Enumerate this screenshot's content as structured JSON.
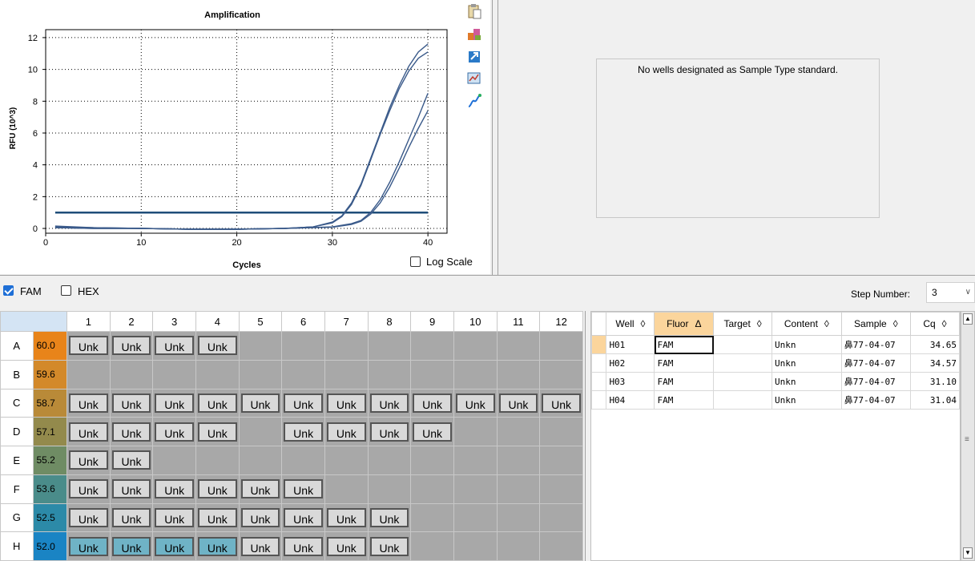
{
  "chart": {
    "title": "Amplification",
    "xlabel": "Cycles",
    "ylabel": "RFU (10^3)",
    "log_scale_label": "Log Scale",
    "log_scale_checked": false
  },
  "chart_data": {
    "type": "line",
    "title": "Amplification",
    "xlabel": "Cycles",
    "ylabel": "RFU (10^3)",
    "xlim": [
      0,
      42
    ],
    "ylim": [
      -0.3,
      12.5
    ],
    "xticks": [
      0,
      10,
      20,
      30,
      40
    ],
    "yticks": [
      0,
      2,
      4,
      6,
      8,
      10,
      12
    ],
    "grid": true,
    "threshold": 1.0,
    "series": [
      {
        "x": [
          1,
          5,
          10,
          15,
          20,
          25,
          28,
          30,
          31,
          32,
          33,
          34,
          35,
          36,
          37,
          38,
          39,
          40
        ],
        "y": [
          0.15,
          0.05,
          0,
          -0.05,
          -0.05,
          0,
          0.1,
          0.4,
          0.8,
          1.6,
          2.8,
          4.4,
          6.0,
          7.6,
          9.0,
          10.2,
          11.1,
          11.6
        ]
      },
      {
        "x": [
          1,
          5,
          10,
          15,
          20,
          25,
          28,
          30,
          31,
          32,
          33,
          34,
          35,
          36,
          37,
          38,
          39,
          40
        ],
        "y": [
          0.1,
          0.05,
          0,
          -0.05,
          -0.05,
          0,
          0.1,
          0.35,
          0.75,
          1.5,
          2.7,
          4.3,
          5.9,
          7.4,
          8.8,
          9.9,
          10.7,
          11.1
        ]
      },
      {
        "x": [
          1,
          5,
          10,
          15,
          20,
          25,
          30,
          32,
          33,
          34,
          35,
          36,
          37,
          38,
          39,
          40
        ],
        "y": [
          0.05,
          0,
          0,
          -0.05,
          -0.05,
          0,
          0.1,
          0.3,
          0.5,
          1.0,
          1.8,
          2.9,
          4.2,
          5.6,
          7.0,
          8.5
        ]
      },
      {
        "x": [
          1,
          5,
          10,
          15,
          20,
          25,
          30,
          32,
          33,
          34,
          35,
          36,
          37,
          38,
          39,
          40
        ],
        "y": [
          0.05,
          0,
          0,
          -0.05,
          -0.05,
          0,
          0.08,
          0.25,
          0.45,
          0.9,
          1.6,
          2.6,
          3.8,
          5.1,
          6.3,
          7.4
        ]
      }
    ]
  },
  "toolbar_icons": [
    "clipboard-icon",
    "chart-colors-icon",
    "export-icon",
    "zoom-chart-icon",
    "curve-settings-icon"
  ],
  "std_curve": {
    "message": "No wells designated as Sample Type standard."
  },
  "filters": {
    "fam_label": "FAM",
    "fam_checked": true,
    "hex_label": "HEX",
    "hex_checked": false
  },
  "step": {
    "label": "Step Number:",
    "value": "3"
  },
  "plate": {
    "columns": [
      "1",
      "2",
      "3",
      "4",
      "5",
      "6",
      "7",
      "8",
      "9",
      "10",
      "11",
      "12"
    ],
    "rows": [
      {
        "letter": "A",
        "temp": "60.0",
        "temp_color": "#e8841a",
        "wells": [
          1,
          1,
          1,
          1,
          0,
          0,
          0,
          0,
          0,
          0,
          0,
          0
        ]
      },
      {
        "letter": "B",
        "temp": "59.6",
        "temp_color": "#d3892a",
        "wells": [
          0,
          0,
          0,
          0,
          0,
          0,
          0,
          0,
          0,
          0,
          0,
          0
        ]
      },
      {
        "letter": "C",
        "temp": "58.7",
        "temp_color": "#b98a38",
        "wells": [
          1,
          1,
          1,
          1,
          1,
          1,
          1,
          1,
          1,
          1,
          1,
          1
        ]
      },
      {
        "letter": "D",
        "temp": "57.1",
        "temp_color": "#938a4c",
        "wells": [
          1,
          1,
          1,
          1,
          0,
          1,
          1,
          1,
          1,
          0,
          0,
          0
        ]
      },
      {
        "letter": "E",
        "temp": "55.2",
        "temp_color": "#6f8c64",
        "wells": [
          1,
          1,
          0,
          0,
          0,
          0,
          0,
          0,
          0,
          0,
          0,
          0
        ]
      },
      {
        "letter": "F",
        "temp": "53.6",
        "temp_color": "#4a8c8a",
        "wells": [
          1,
          1,
          1,
          1,
          1,
          1,
          0,
          0,
          0,
          0,
          0,
          0
        ]
      },
      {
        "letter": "G",
        "temp": "52.5",
        "temp_color": "#2c8aa8",
        "wells": [
          1,
          1,
          1,
          1,
          1,
          1,
          1,
          1,
          0,
          0,
          0,
          0
        ]
      },
      {
        "letter": "H",
        "temp": "52.0",
        "temp_color": "#1a84c4",
        "wells": [
          2,
          2,
          2,
          2,
          1,
          1,
          1,
          1,
          0,
          0,
          0,
          0
        ]
      }
    ],
    "unk_label": "Unk"
  },
  "well_table": {
    "headers": [
      "Well",
      "Fluor",
      "Target",
      "Content",
      "Sample",
      "Cq"
    ],
    "sort_mark": "◊",
    "sorted_mark": "Δ",
    "rows": [
      {
        "well": "H01",
        "fluor": "FAM",
        "target": "",
        "content": "Unkn",
        "sample": "鼻77-04-07",
        "cq": "34.65"
      },
      {
        "well": "H02",
        "fluor": "FAM",
        "target": "",
        "content": "Unkn",
        "sample": "鼻77-04-07",
        "cq": "34.57"
      },
      {
        "well": "H03",
        "fluor": "FAM",
        "target": "",
        "content": "Unkn",
        "sample": "鼻77-04-07",
        "cq": "31.10"
      },
      {
        "well": "H04",
        "fluor": "FAM",
        "target": "",
        "content": "Unkn",
        "sample": "鼻77-04-07",
        "cq": "31.04"
      }
    ]
  }
}
